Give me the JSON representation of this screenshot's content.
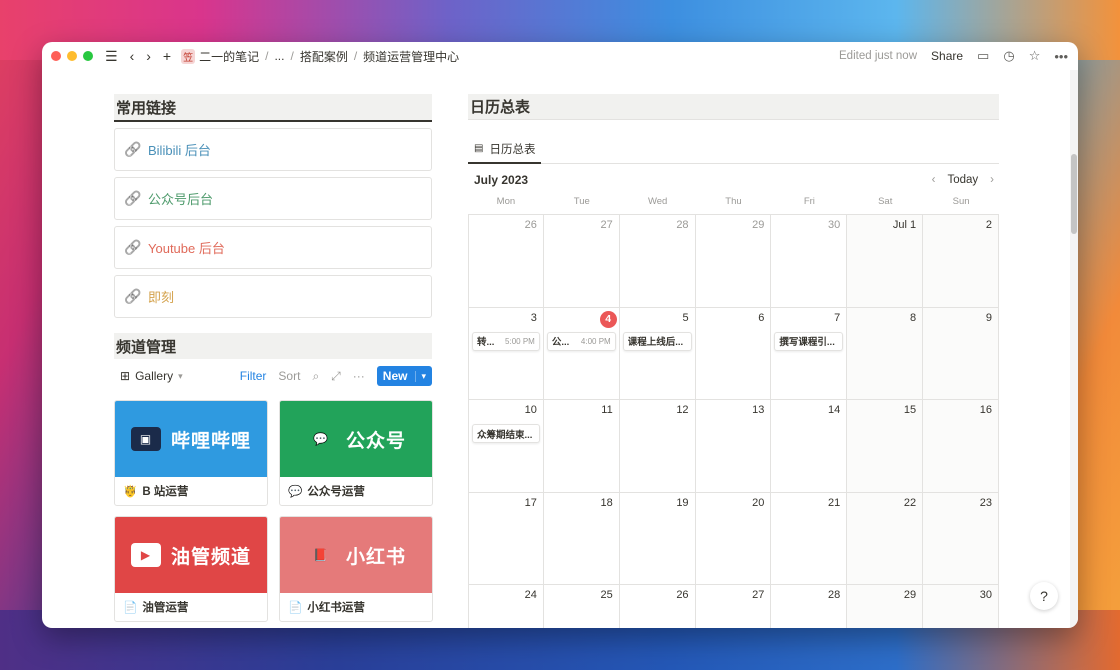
{
  "breadcrumb": {
    "workspace_emoji": "笠",
    "items": [
      "二一的笔记",
      "...",
      "搭配案例",
      "频道运营管理中心"
    ],
    "separator": "/"
  },
  "toolbar": {
    "edited": "Edited just now",
    "share": "Share"
  },
  "links_section": {
    "title": "常用链接",
    "items": [
      {
        "label": "Bilibili 后台",
        "color": "#4a90b8"
      },
      {
        "label": "公众号后台",
        "color": "#4d9a6b"
      },
      {
        "label": "Youtube 后台",
        "color": "#e06a5a"
      },
      {
        "label": "即刻",
        "color": "#d4a24c"
      }
    ]
  },
  "channel_section": {
    "title": "频道管理",
    "view_label": "Gallery",
    "filter": "Filter",
    "sort": "Sort",
    "new_label": "New",
    "cards": [
      {
        "cover_text": "哔哩哔哩",
        "cover_color": "#2f9ae0",
        "icon": "tv-icon",
        "title_emoji": "🤴",
        "title": "B 站运营"
      },
      {
        "cover_text": "公众号",
        "cover_color": "#22a35a",
        "icon": "wechat-icon",
        "title_emoji": "💬",
        "title": "公众号运营"
      },
      {
        "cover_text": "油管频道",
        "cover_color": "#e04646",
        "icon": "youtube-icon",
        "title_emoji": "📄",
        "title": "油管运营"
      },
      {
        "cover_text": "小红书",
        "cover_color": "#e57a7a",
        "icon": "book-icon",
        "title_emoji": "📄",
        "title": "小红书运营"
      }
    ]
  },
  "calendar": {
    "title": "日历总表",
    "view_tab": "日历总表",
    "month": "July 2023",
    "today_label": "Today",
    "weekdays": [
      "Mon",
      "Tue",
      "Wed",
      "Thu",
      "Fri",
      "Sat",
      "Sun"
    ],
    "today_day": "4",
    "days": [
      {
        "d": "26",
        "muted": true
      },
      {
        "d": "27",
        "muted": true
      },
      {
        "d": "28",
        "muted": true
      },
      {
        "d": "29",
        "muted": true
      },
      {
        "d": "30",
        "muted": true
      },
      {
        "d": "Jul 1"
      },
      {
        "d": "2"
      },
      {
        "d": "3",
        "event": {
          "title": "转...",
          "time": "5:00 PM"
        }
      },
      {
        "d": "4",
        "today": true,
        "event": {
          "title": "公...",
          "time": "4:00 PM"
        }
      },
      {
        "d": "5",
        "event": {
          "title": "课程上线后...",
          "time": ""
        }
      },
      {
        "d": "6"
      },
      {
        "d": "7",
        "event": {
          "title": "撰写课程引...",
          "time": ""
        }
      },
      {
        "d": "8"
      },
      {
        "d": "9"
      },
      {
        "d": "10",
        "event": {
          "title": "众筹期结束...",
          "time": ""
        }
      },
      {
        "d": "11"
      },
      {
        "d": "12"
      },
      {
        "d": "13"
      },
      {
        "d": "14"
      },
      {
        "d": "15"
      },
      {
        "d": "16"
      },
      {
        "d": "17"
      },
      {
        "d": "18"
      },
      {
        "d": "19"
      },
      {
        "d": "20"
      },
      {
        "d": "21"
      },
      {
        "d": "22"
      },
      {
        "d": "23"
      },
      {
        "d": "24"
      },
      {
        "d": "25"
      },
      {
        "d": "26"
      },
      {
        "d": "27"
      },
      {
        "d": "28"
      },
      {
        "d": "29"
      },
      {
        "d": "30"
      }
    ]
  },
  "help": "?"
}
